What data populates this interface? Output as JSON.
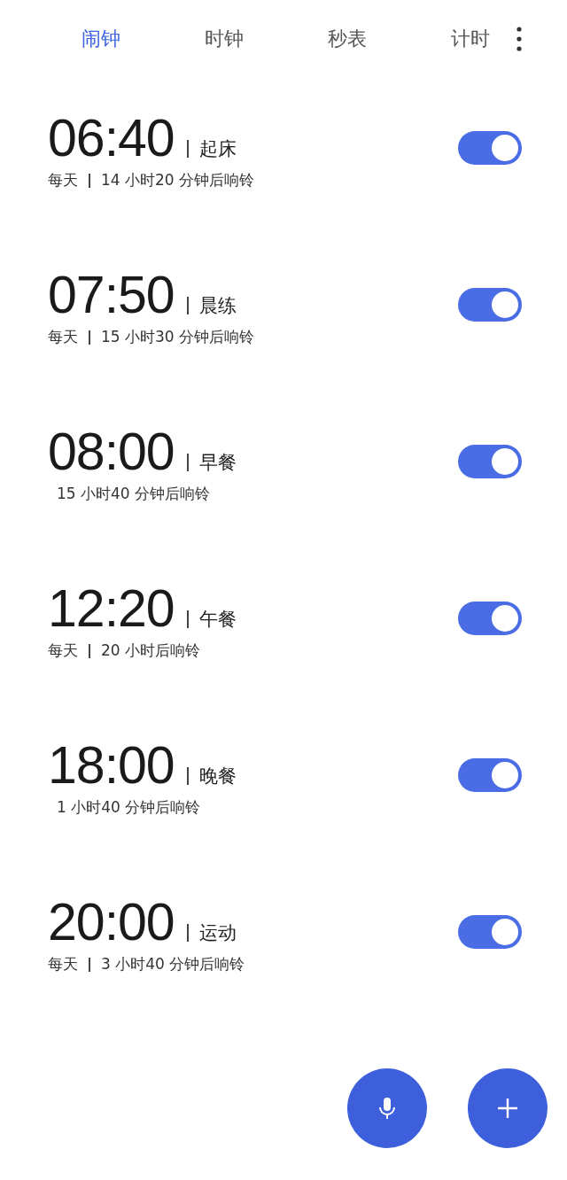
{
  "tabs": [
    {
      "label": "闹钟",
      "selected": true
    },
    {
      "label": "时钟",
      "selected": false
    },
    {
      "label": "秒表",
      "selected": false
    },
    {
      "label": "计时",
      "selected": false
    }
  ],
  "alarms": [
    {
      "time": "06:40",
      "label": "起床",
      "repeat": "每天",
      "countdown": "14 小时20 分钟后响铃",
      "on": true
    },
    {
      "time": "07:50",
      "label": "晨练",
      "repeat": "每天",
      "countdown": "15 小时30 分钟后响铃",
      "on": true
    },
    {
      "time": "08:00",
      "label": "早餐",
      "countdown": "15 小时40 分钟后响铃",
      "on": true
    },
    {
      "time": "12:20",
      "label": "午餐",
      "repeat": "每天",
      "countdown": "20 小时后响铃",
      "on": true
    },
    {
      "time": "18:00",
      "label": "晚餐",
      "countdown": "1 小时40 分钟后响铃",
      "on": true
    },
    {
      "time": "20:00",
      "label": "运动",
      "repeat": "每天",
      "countdown": "3 小时40 分钟后响铃",
      "on": true
    }
  ]
}
